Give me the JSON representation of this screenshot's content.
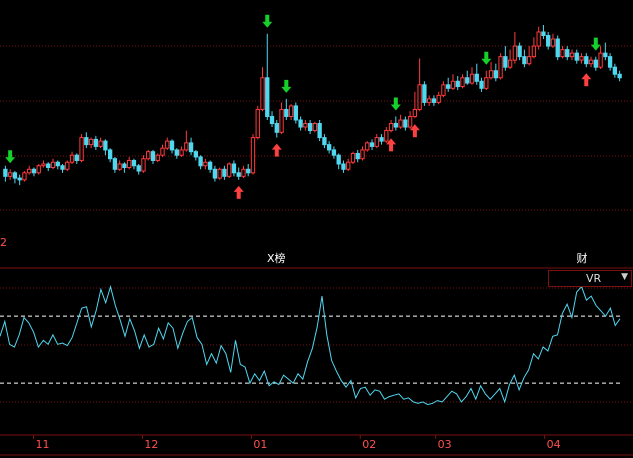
{
  "colors": {
    "background": "#000000",
    "up": "#ff3a3a",
    "down": "#4fd8f0",
    "grid": "#7a1010",
    "indicator_line": "#4fd8f0",
    "ref_line": "#ffffff",
    "signal_buy": "#ff4040",
    "signal_sell": "#16d12a",
    "label": "#ff5050"
  },
  "ui": {
    "indicator_name": "VR",
    "dropdown_icon": "triangle-down-icon",
    "corner_label": "2"
  },
  "events": [
    {
      "text": "X榜",
      "index": 56
    },
    {
      "text": "财",
      "index": 121
    }
  ],
  "chart_data": [
    {
      "type": "candlestick",
      "panel": "price",
      "n_bars": 130,
      "ylim": [
        0,
        100
      ],
      "candles": [
        [
          22,
          18,
          24,
          15
        ],
        [
          18,
          20,
          22,
          16
        ],
        [
          20,
          17,
          21,
          14
        ],
        [
          17,
          16,
          19,
          13
        ],
        [
          16,
          20,
          21,
          15
        ],
        [
          20,
          22,
          24,
          19
        ],
        [
          22,
          20,
          23,
          18
        ],
        [
          20,
          24,
          25,
          19
        ],
        [
          24,
          25,
          27,
          23
        ],
        [
          25,
          23,
          26,
          21
        ],
        [
          23,
          26,
          28,
          22
        ],
        [
          26,
          24,
          27,
          22
        ],
        [
          24,
          22,
          25,
          20
        ],
        [
          22,
          26,
          27,
          21
        ],
        [
          26,
          30,
          32,
          25
        ],
        [
          30,
          27,
          31,
          25
        ],
        [
          27,
          40,
          42,
          26
        ],
        [
          40,
          36,
          43,
          34
        ],
        [
          36,
          39,
          40,
          34
        ],
        [
          39,
          35,
          41,
          33
        ],
        [
          35,
          38,
          40,
          34
        ],
        [
          38,
          33,
          39,
          30
        ],
        [
          33,
          28,
          34,
          26
        ],
        [
          28,
          22,
          29,
          20
        ],
        [
          22,
          25,
          27,
          21
        ],
        [
          25,
          23,
          26,
          20
        ],
        [
          23,
          27,
          29,
          22
        ],
        [
          27,
          24,
          28,
          22
        ],
        [
          24,
          21,
          25,
          19
        ],
        [
          21,
          28,
          30,
          20
        ],
        [
          28,
          32,
          33,
          27
        ],
        [
          32,
          27,
          33,
          25
        ],
        [
          27,
          30,
          31,
          26
        ],
        [
          30,
          34,
          36,
          29
        ],
        [
          34,
          38,
          40,
          33
        ],
        [
          38,
          33,
          39,
          31
        ],
        [
          33,
          30,
          34,
          28
        ],
        [
          30,
          33,
          35,
          29
        ],
        [
          33,
          37,
          44,
          32
        ],
        [
          37,
          32,
          40,
          30
        ],
        [
          32,
          29,
          33,
          27
        ],
        [
          29,
          24,
          30,
          22
        ],
        [
          24,
          26,
          28,
          22
        ],
        [
          26,
          22,
          27,
          20
        ],
        [
          22,
          17,
          24,
          15
        ],
        [
          17,
          22,
          23,
          16
        ],
        [
          22,
          18,
          24,
          16
        ],
        [
          18,
          25,
          26,
          17
        ],
        [
          25,
          20,
          27,
          18
        ],
        [
          20,
          18,
          23,
          16
        ],
        [
          18,
          22,
          24,
          17
        ],
        [
          22,
          20,
          25,
          18
        ],
        [
          20,
          40,
          42,
          19
        ],
        [
          40,
          56,
          58,
          39
        ],
        [
          56,
          74,
          80,
          55
        ],
        [
          74,
          52,
          99,
          50
        ],
        [
          52,
          48,
          55,
          46
        ],
        [
          48,
          43,
          50,
          40
        ],
        [
          43,
          56,
          60,
          42
        ],
        [
          56,
          52,
          62,
          50
        ],
        [
          52,
          58,
          59,
          50
        ],
        [
          58,
          50,
          60,
          48
        ],
        [
          50,
          46,
          52,
          44
        ],
        [
          46,
          48,
          50,
          44
        ],
        [
          48,
          44,
          50,
          42
        ],
        [
          44,
          48,
          49,
          43
        ],
        [
          48,
          40,
          50,
          38
        ],
        [
          40,
          36,
          42,
          34
        ],
        [
          36,
          33,
          38,
          31
        ],
        [
          33,
          30,
          35,
          28
        ],
        [
          30,
          25,
          31,
          22
        ],
        [
          25,
          22,
          27,
          20
        ],
        [
          22,
          26,
          28,
          21
        ],
        [
          26,
          31,
          32,
          25
        ],
        [
          31,
          28,
          33,
          26
        ],
        [
          28,
          33,
          35,
          27
        ],
        [
          33,
          37,
          38,
          32
        ],
        [
          37,
          35,
          39,
          33
        ],
        [
          35,
          40,
          42,
          34
        ],
        [
          40,
          38,
          42,
          36
        ],
        [
          38,
          44,
          46,
          37
        ],
        [
          44,
          48,
          50,
          43
        ],
        [
          48,
          46,
          52,
          44
        ],
        [
          46,
          50,
          53,
          45
        ],
        [
          50,
          46,
          52,
          44
        ],
        [
          46,
          52,
          55,
          45
        ],
        [
          52,
          56,
          66,
          51
        ],
        [
          56,
          70,
          85,
          55
        ],
        [
          70,
          60,
          72,
          58
        ],
        [
          60,
          62,
          64,
          58
        ],
        [
          62,
          60,
          64,
          58
        ],
        [
          60,
          64,
          66,
          59
        ],
        [
          64,
          70,
          72,
          63
        ],
        [
          70,
          68,
          74,
          66
        ],
        [
          68,
          72,
          76,
          67
        ],
        [
          72,
          69,
          75,
          67
        ],
        [
          69,
          74,
          76,
          68
        ],
        [
          74,
          71,
          78,
          70
        ],
        [
          71,
          76,
          80,
          70
        ],
        [
          76,
          72,
          82,
          70
        ],
        [
          72,
          68,
          74,
          66
        ],
        [
          68,
          74,
          78,
          67
        ],
        [
          74,
          78,
          83,
          73
        ],
        [
          78,
          74,
          82,
          72
        ],
        [
          74,
          86,
          88,
          73
        ],
        [
          86,
          80,
          92,
          78
        ],
        [
          80,
          84,
          90,
          79
        ],
        [
          84,
          92,
          100,
          82
        ],
        [
          92,
          86,
          94,
          84
        ],
        [
          86,
          82,
          90,
          80
        ],
        [
          82,
          86,
          92,
          81
        ],
        [
          86,
          92,
          97,
          85
        ],
        [
          92,
          100,
          103,
          90
        ],
        [
          100,
          98,
          104,
          96
        ],
        [
          98,
          92,
          100,
          90
        ],
        [
          92,
          96,
          99,
          91
        ],
        [
          96,
          86,
          98,
          84
        ],
        [
          86,
          90,
          92,
          85
        ],
        [
          90,
          86,
          92,
          84
        ],
        [
          86,
          88,
          90,
          84
        ],
        [
          88,
          84,
          90,
          82
        ],
        [
          84,
          86,
          88,
          82
        ],
        [
          86,
          82,
          88,
          80
        ],
        [
          82,
          84,
          86,
          80
        ],
        [
          84,
          80,
          86,
          78
        ],
        [
          80,
          88,
          92,
          79
        ],
        [
          88,
          86,
          94,
          84
        ],
        [
          86,
          80,
          88,
          78
        ],
        [
          80,
          76,
          82,
          74
        ],
        [
          76,
          74,
          78,
          72
        ]
      ],
      "signals": [
        {
          "index": 1,
          "direction": "down"
        },
        {
          "index": 55,
          "direction": "down"
        },
        {
          "index": 59,
          "direction": "down"
        },
        {
          "index": 82,
          "direction": "down"
        },
        {
          "index": 101,
          "direction": "down"
        },
        {
          "index": 124,
          "direction": "down"
        },
        {
          "index": 49,
          "direction": "up"
        },
        {
          "index": 57,
          "direction": "up"
        },
        {
          "index": 81,
          "direction": "up"
        },
        {
          "index": 86,
          "direction": "up"
        },
        {
          "index": 122,
          "direction": "up"
        }
      ]
    },
    {
      "type": "line",
      "panel": "indicator",
      "name": "VR",
      "ylim": [
        0,
        100
      ],
      "ref_lines": [
        76,
        26
      ],
      "values": [
        61,
        72,
        55,
        53,
        62,
        75,
        71,
        64,
        53,
        58,
        55,
        62,
        55,
        56,
        54,
        60,
        71,
        82,
        83,
        68,
        80,
        96,
        86,
        98,
        84,
        73,
        61,
        74,
        65,
        52,
        62,
        53,
        55,
        67,
        59,
        71,
        67,
        52,
        63,
        72,
        75,
        60,
        55,
        40,
        48,
        41,
        54,
        48,
        34,
        58,
        40,
        38,
        26,
        33,
        28,
        35,
        24,
        27,
        25,
        32,
        29,
        26,
        33,
        29,
        42,
        52,
        68,
        91,
        62,
        43,
        35,
        28,
        23,
        28,
        15,
        22,
        23,
        17,
        21,
        20,
        14,
        16,
        17,
        18,
        14,
        15,
        12,
        11,
        12,
        10,
        11,
        13,
        12,
        16,
        20,
        18,
        12,
        16,
        22,
        14,
        24,
        18,
        14,
        18,
        22,
        12,
        25,
        32,
        21,
        30,
        36,
        48,
        44,
        53,
        50,
        61,
        62,
        78,
        85,
        75,
        94,
        98,
        88,
        91,
        84,
        80,
        76,
        82,
        69,
        74
      ]
    }
  ],
  "x_axis": {
    "bar_labels": [
      {
        "text": "11",
        "index": 4
      },
      {
        "text": "12",
        "index": 17
      },
      {
        "text": "01",
        "index": 30
      },
      {
        "text": "02",
        "index": 43
      },
      {
        "text": "03",
        "index": 52
      },
      {
        "text": "04",
        "index": 65
      }
    ],
    "indicator_count": 75
  }
}
